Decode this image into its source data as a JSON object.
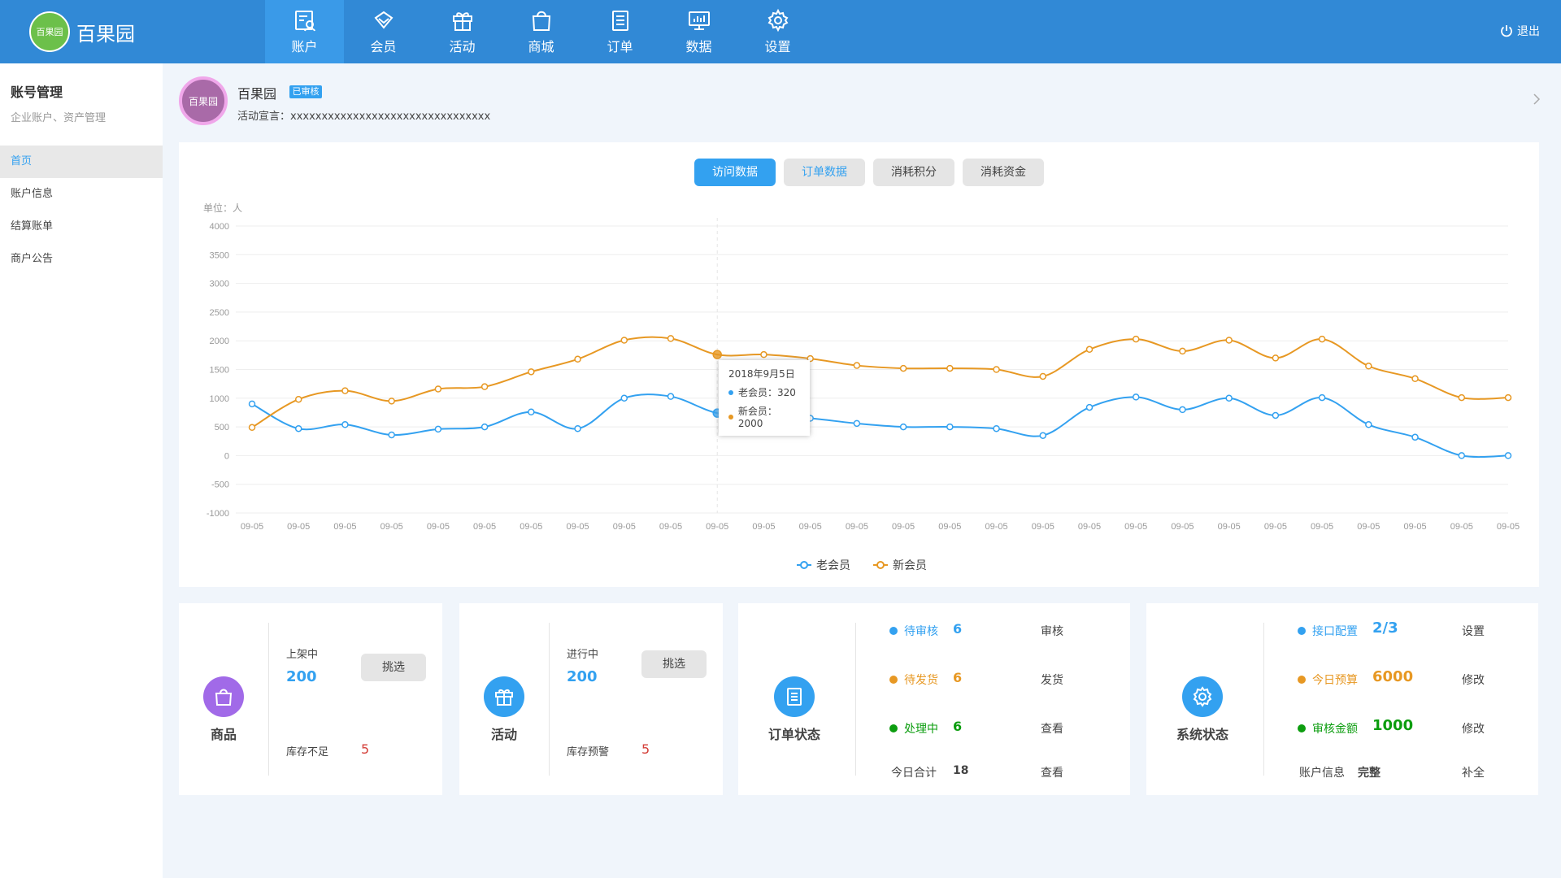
{
  "app": {
    "name": "百果园",
    "logo_text": "百果园"
  },
  "nav": {
    "items": [
      {
        "label": "账户",
        "icon": "account-icon",
        "active": true
      },
      {
        "label": "会员",
        "icon": "diamond-icon"
      },
      {
        "label": "活动",
        "icon": "gift-icon"
      },
      {
        "label": "商城",
        "icon": "bag-icon"
      },
      {
        "label": "订单",
        "icon": "list-icon"
      },
      {
        "label": "数据",
        "icon": "monitor-icon"
      },
      {
        "label": "设置",
        "icon": "gear-icon"
      }
    ],
    "logout_label": "退出"
  },
  "sidebar": {
    "title": "账号管理",
    "subtitle": "企业账户、资产管理",
    "items": [
      {
        "label": "首页",
        "active": true
      },
      {
        "label": "账户信息"
      },
      {
        "label": "结算账单"
      },
      {
        "label": "商户公告"
      }
    ]
  },
  "account": {
    "name": "百果园",
    "badge": "已审核",
    "avatar_text": "百果园",
    "slogan": "活动宣言：xxxxxxxxxxxxxxxxxxxxxxxxxxxxxxxx"
  },
  "chart_tabs": [
    {
      "label": "访问数据",
      "state": "active"
    },
    {
      "label": "订单数据",
      "state": "hover"
    },
    {
      "label": "消耗积分",
      "state": "default"
    },
    {
      "label": "消耗资金",
      "state": "default"
    }
  ],
  "colors": {
    "primary": "#33a1f0",
    "orange": "#e79823",
    "green": "#0c9d0f",
    "red": "#d43f39",
    "gray_fill": "#e5e5e5",
    "bg": "#f0f5fb",
    "text": "#444444",
    "muted": "#999999"
  },
  "chart_data": {
    "type": "line",
    "unit_label": "单位：人",
    "ylim": [
      -1000,
      4000
    ],
    "yticks": [
      4000,
      3500,
      3000,
      2500,
      2000,
      1500,
      1000,
      500,
      0,
      -500,
      -1000
    ],
    "categories": [
      "09-05",
      "09-05",
      "09-05",
      "09-05",
      "09-05",
      "09-05",
      "09-05",
      "09-05",
      "09-05",
      "09-05",
      "09-05",
      "09-05",
      "09-05",
      "09-05",
      "09-05",
      "09-05",
      "09-05",
      "09-05",
      "09-05",
      "09-05",
      "09-05",
      "09-05",
      "09-05",
      "09-05",
      "09-05",
      "09-05",
      "09-05",
      "09-05"
    ],
    "series": [
      {
        "name": "老会员",
        "color": "#33a1f0",
        "values": [
          900,
          470,
          540,
          360,
          460,
          500,
          760,
          470,
          1000,
          1030,
          740,
          700,
          650,
          560,
          500,
          500,
          470,
          350,
          840,
          1020,
          800,
          1000,
          700,
          1010,
          540,
          320,
          0,
          0
        ]
      },
      {
        "name": "新会员",
        "color": "#e79823",
        "values": [
          490,
          980,
          1130,
          950,
          1160,
          1200,
          1460,
          1680,
          2010,
          2040,
          1760,
          1760,
          1690,
          1570,
          1520,
          1520,
          1500,
          1380,
          1850,
          2030,
          1820,
          2010,
          1700,
          2030,
          1560,
          1340,
          1010,
          1010
        ]
      }
    ],
    "tooltip": {
      "title": "2018年9月5日",
      "rows": [
        {
          "label": "老会员：320",
          "color": "#33a1f0"
        },
        {
          "label": "新会员：2000",
          "color": "#e79823"
        }
      ]
    },
    "highlight_index": 10,
    "legend": [
      "老会员",
      "新会员"
    ],
    "legend_position": "bottom-center"
  },
  "cards": {
    "goods": {
      "label": "商品",
      "on_sale_label": "上架中",
      "on_sale_value": "200",
      "filter_label": "挑选",
      "low_stock_label": "库存不足",
      "low_stock_value": "5"
    },
    "activity": {
      "label": "活动",
      "running_label": "进行中",
      "running_value": "200",
      "filter_label": "挑选",
      "warning_label": "库存预警",
      "warning_value": "5"
    },
    "orders": {
      "label": "订单状态",
      "rows": [
        {
          "status": "待审核",
          "value": "6",
          "action": "审核",
          "color": "#33a1f0"
        },
        {
          "status": "待发货",
          "value": "6",
          "action": "发货",
          "color": "#e79823"
        },
        {
          "status": "处理中",
          "value": "6",
          "action": "查看",
          "color": "#0c9d0f"
        }
      ],
      "total_label": "今日合计",
      "total_value": "18",
      "total_action": "查看"
    },
    "system": {
      "label": "系统状态",
      "rows": [
        {
          "label": "接口配置",
          "value": "2/3",
          "action": "设置",
          "color": "#33a1f0"
        },
        {
          "label": "今日预算",
          "value": "6000",
          "action": "修改",
          "color": "#e79823"
        },
        {
          "label": "审核金额",
          "value": "1000",
          "action": "修改",
          "color": "#0c9d0f"
        }
      ],
      "info_label": "账户信息",
      "info_value": "完整",
      "info_action": "补全"
    }
  }
}
